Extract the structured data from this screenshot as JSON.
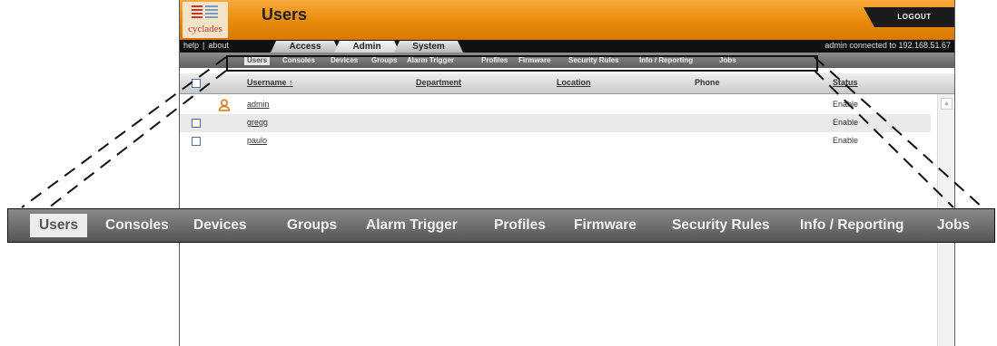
{
  "logo": {
    "text": "cyclades",
    "icon": "cyclades-logo"
  },
  "header": {
    "title": "Users",
    "logout_label": "LOGOUT"
  },
  "links": {
    "help": "help",
    "separator": "|",
    "about": "about"
  },
  "connection_status": "admin connected to 192.168.51.67",
  "main_tabs": [
    {
      "label": "Access",
      "active": false
    },
    {
      "label": "Admin",
      "active": true
    },
    {
      "label": "System",
      "active": false
    }
  ],
  "subnav": {
    "items": [
      "Users",
      "Consoles",
      "Devices",
      "Groups",
      "Alarm Trigger",
      "Profiles",
      "Firmware",
      "Security Rules",
      "Info / Reporting",
      "Jobs"
    ],
    "selected": "Users"
  },
  "table": {
    "columns": [
      "Username",
      "Department",
      "Location",
      "Phone",
      "Status"
    ],
    "sort_indicator": "↑",
    "rows": [
      {
        "username": "admin",
        "department": "",
        "location": "",
        "phone": "",
        "status": "Enable",
        "icon": "user-icon"
      },
      {
        "username": "gregg",
        "department": "",
        "location": "",
        "phone": "",
        "status": "Enable"
      },
      {
        "username": "paulo",
        "department": "",
        "location": "",
        "phone": "",
        "status": "Enable"
      }
    ]
  },
  "colors": {
    "header_orange": "#e98a0c",
    "logout_black": "#1b1b1b",
    "user_icon": "#d4780a"
  }
}
